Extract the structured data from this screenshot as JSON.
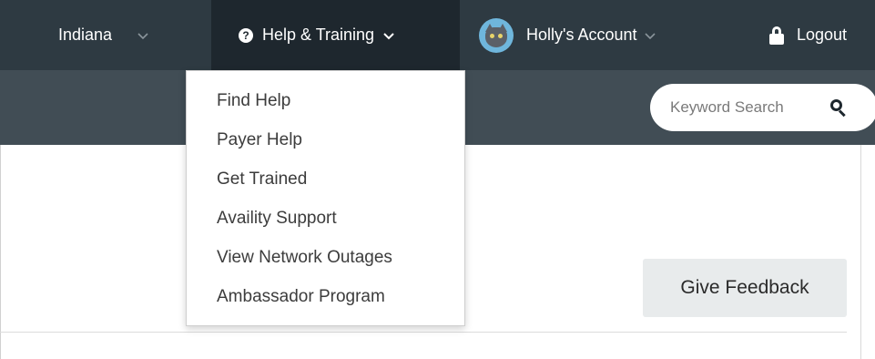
{
  "topnav": {
    "state_label": "Indiana",
    "help_label": "Help & Training",
    "account_label": "Holly's Account",
    "logout_label": "Logout",
    "bg_color": "#2e3a42",
    "active_bg_color": "#1e272e"
  },
  "subnav": {
    "search_placeholder": "Keyword Search",
    "bg_color": "#414d55"
  },
  "help_menu": {
    "items": [
      {
        "label": "Find Help"
      },
      {
        "label": "Payer Help"
      },
      {
        "label": "Get Trained"
      },
      {
        "label": "Availity Support"
      },
      {
        "label": "View Network Outages"
      },
      {
        "label": "Ambassador Program"
      }
    ]
  },
  "main": {
    "feedback_label": "Give Feedback"
  },
  "icons": {
    "help": "question-circle-icon",
    "chevron": "chevron-down-icon",
    "avatar": "cat-avatar",
    "logout": "lock-icon",
    "search": "search-icon"
  }
}
